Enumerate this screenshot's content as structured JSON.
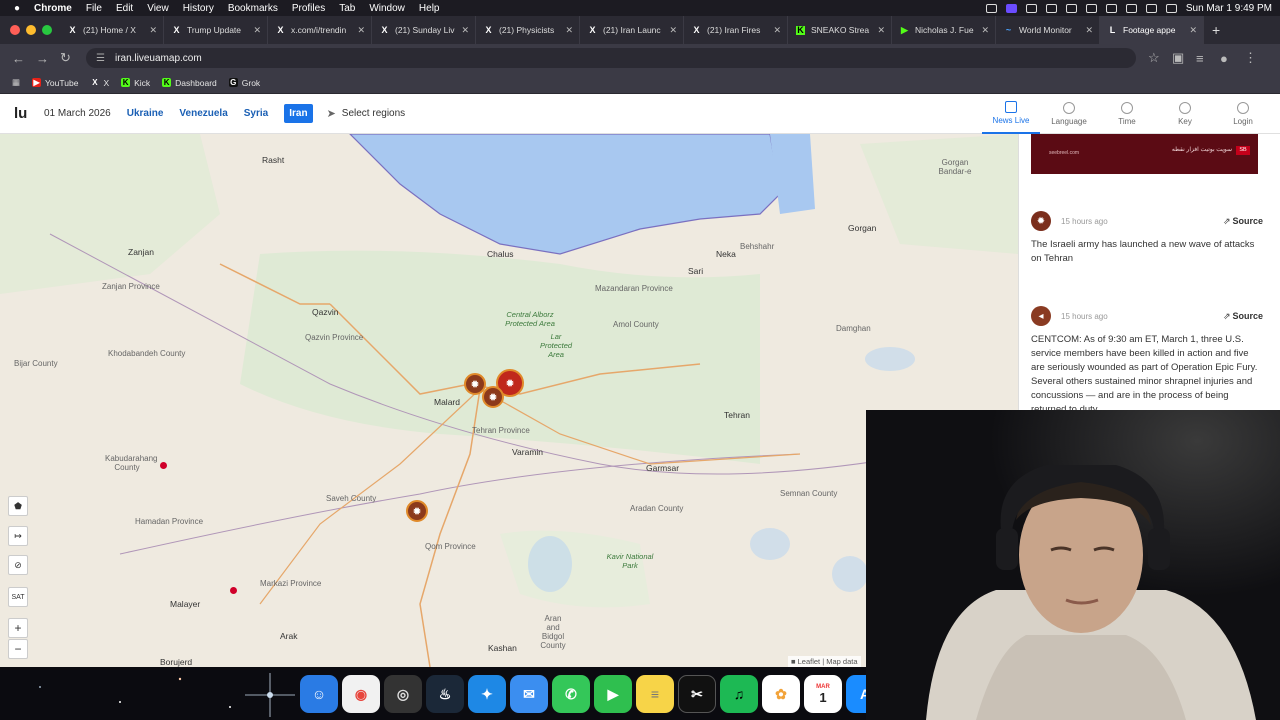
{
  "menubar": {
    "apple": "",
    "items": [
      "Chrome",
      "File",
      "Edit",
      "View",
      "History",
      "Bookmarks",
      "Profiles",
      "Tab",
      "Window",
      "Help"
    ],
    "clock": "Sun Mar 1  9:49 PM"
  },
  "tabs": [
    {
      "label": "(21) Home / X",
      "icon": "X"
    },
    {
      "label": "Trump Update",
      "icon": "X"
    },
    {
      "label": "x.com/i/trendin",
      "icon": "X"
    },
    {
      "label": "(21) Sunday Liv",
      "icon": "X"
    },
    {
      "label": "(21) Physicists",
      "icon": "X"
    },
    {
      "label": "(21) Iran Launc",
      "icon": "X"
    },
    {
      "label": "(21) Iran Fires",
      "icon": "X"
    },
    {
      "label": "SNEAKO Strea",
      "icon": "K"
    },
    {
      "label": "Nicholas J. Fue",
      "icon": "▶"
    },
    {
      "label": "World Monitor",
      "icon": "~"
    },
    {
      "label": "Footage appe",
      "icon": "L"
    }
  ],
  "address": {
    "url": "iran.liveuamap.com"
  },
  "bookmarks": [
    {
      "label": "YouTube",
      "icon": "▶",
      "color": "#e62117"
    },
    {
      "label": "X",
      "icon": "X",
      "color": "#000000"
    },
    {
      "label": "Kick",
      "icon": "K",
      "color": "#53fc18"
    },
    {
      "label": "Dashboard",
      "icon": "K",
      "color": "#53fc18"
    },
    {
      "label": "Grok",
      "icon": "G",
      "color": "#222222"
    }
  ],
  "site": {
    "logo": "lu",
    "date": "01 March 2026",
    "regions": [
      "Ukraine",
      "Venezuela",
      "Syria",
      "Iran"
    ],
    "active_region": "Iran",
    "select_regions": "Select regions",
    "nav": [
      {
        "label": "News Live"
      },
      {
        "label": "Language"
      },
      {
        "label": "Time"
      },
      {
        "label": "Key"
      },
      {
        "label": "Login"
      }
    ]
  },
  "map": {
    "labels": [
      {
        "t": "Rasht",
        "cls": "city"
      },
      {
        "t": "Zanjan",
        "cls": "city"
      },
      {
        "t": "Qazvin",
        "cls": "city"
      },
      {
        "t": "Qazvin Province",
        "cls": ""
      },
      {
        "t": "Malard",
        "cls": "city"
      },
      {
        "t": "Tehran Province",
        "cls": ""
      },
      {
        "t": "Varamin",
        "cls": "city"
      },
      {
        "t": "Chalus",
        "cls": "city"
      },
      {
        "t": "Amol County",
        "cls": ""
      },
      {
        "t": "Sari",
        "cls": "city"
      },
      {
        "t": "Mazandaran Province",
        "cls": ""
      },
      {
        "t": "Neka",
        "cls": "city"
      },
      {
        "t": "Gorgan",
        "cls": "city"
      },
      {
        "t": "Behshahr",
        "cls": ""
      },
      {
        "t": "Damghan",
        "cls": ""
      },
      {
        "t": "Central Alborz Protected Area",
        "cls": "green"
      },
      {
        "t": "Lar Protected Area",
        "cls": "green"
      },
      {
        "t": "Kavir National Park",
        "cls": "green"
      },
      {
        "t": "Qom Province",
        "cls": ""
      },
      {
        "t": "Aran and Bidgol County",
        "cls": ""
      },
      {
        "t": "Kashan",
        "cls": "city"
      },
      {
        "t": "Arak",
        "cls": "city"
      },
      {
        "t": "Malayer",
        "cls": "city"
      },
      {
        "t": "Hamadan Province",
        "cls": ""
      },
      {
        "t": "Kabudarahang County",
        "cls": ""
      },
      {
        "t": "Bijar County",
        "cls": ""
      },
      {
        "t": "Khodabandeh County",
        "cls": ""
      },
      {
        "t": "Saveh County",
        "cls": ""
      },
      {
        "t": "Garmsar",
        "cls": "city"
      },
      {
        "t": "Tehran",
        "cls": "city"
      },
      {
        "t": "Aradan County",
        "cls": ""
      },
      {
        "t": "Semnan County",
        "cls": ""
      },
      {
        "t": "Borujerd",
        "cls": "city"
      },
      {
        "t": "Gorgan Bandar-e",
        "cls": ""
      },
      {
        "t": "Markazi Province",
        "cls": ""
      },
      {
        "t": "Zanjan Province",
        "cls": ""
      }
    ],
    "controls": [
      "⬟",
      "↦",
      "⊘",
      "SAT",
      "+",
      "−"
    ],
    "attribution": "■ Leaflet | Map data"
  },
  "panel": {
    "banner_text": "سوپت بوتیت افزار نقطه",
    "banner_sub": "seebreel.com",
    "banner_badge": "SB",
    "posts": [
      {
        "time": "15 hours ago",
        "source": "Source",
        "text": "The Israeli army has launched a new wave of attacks on Tehran"
      },
      {
        "time": "15 hours ago",
        "source": "Source",
        "text": "CENTCOM: As of 9:30 am ET, March 1, three U.S. service members have been killed in action and five are seriously wounded as part of Operation Epic Fury. Several others sustained minor shrapnel injuries and concussions — and are in the process of being returned to duty."
      }
    ]
  },
  "dock": {
    "apps": [
      {
        "name": "finder",
        "glyph": "☺",
        "color": "#2a7be4"
      },
      {
        "name": "chrome",
        "glyph": "◉",
        "color": "#e8453c"
      },
      {
        "name": "obs",
        "glyph": "◎",
        "color": "#333333"
      },
      {
        "name": "steam",
        "glyph": "♨",
        "color": "#1b2838"
      },
      {
        "name": "safari",
        "glyph": "✦",
        "color": "#1e88e5"
      },
      {
        "name": "mail",
        "glyph": "✉",
        "color": "#3b8ef0"
      },
      {
        "name": "messages",
        "glyph": "✆",
        "color": "#34c759"
      },
      {
        "name": "facetime",
        "glyph": "▶",
        "color": "#2fbf4f"
      },
      {
        "name": "notes",
        "glyph": "≡",
        "color": "#f7d448"
      },
      {
        "name": "capcut",
        "glyph": "✂",
        "color": "#111111"
      },
      {
        "name": "spotify",
        "glyph": "♫",
        "color": "#1db954"
      },
      {
        "name": "photos",
        "glyph": "✿",
        "color": "#f2a33a"
      },
      {
        "name": "calendar",
        "glyph": "1",
        "color": "#ffffff"
      },
      {
        "name": "appstore",
        "glyph": "A",
        "color": "#1a8cff"
      }
    ],
    "calendar_month": "MAR",
    "calendar_day": "1"
  }
}
